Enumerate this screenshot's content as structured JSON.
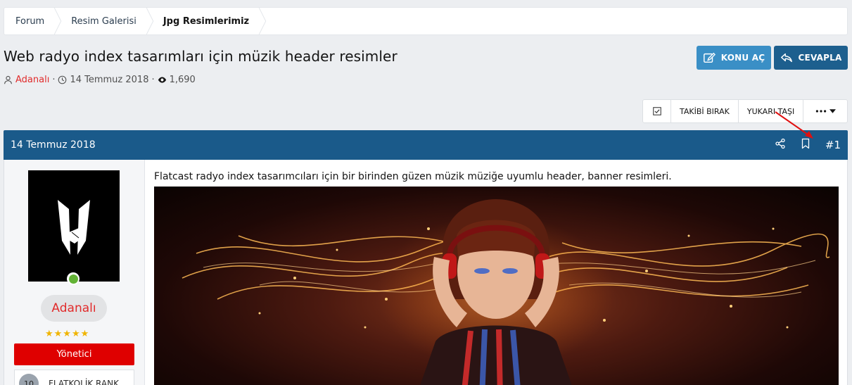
{
  "breadcrumb": {
    "items": [
      {
        "label": "Forum"
      },
      {
        "label": "Resim Galerisi"
      },
      {
        "label": "Jpg Resimlerimiz"
      }
    ]
  },
  "thread": {
    "title": "Web radyo index tasarımları için müzik header resimler",
    "author": "Adanalı",
    "date": "14 Temmuz 2018",
    "views": "1,690"
  },
  "buttons": {
    "new_topic": "KONU AÇ",
    "reply": "CEVAPLA"
  },
  "actions": {
    "unfollow": "TAKİBİ BIRAK",
    "move_up": "YUKARI TAŞI"
  },
  "post": {
    "date": "14 Temmuz 2018",
    "number": "#1",
    "text": "Flatcast radyo index tasarımcıları için bir birinden güzen müzik müziğe uyumlu header, banner resimleri."
  },
  "user": {
    "name": "Adanalı",
    "stars": "★★★★★",
    "role": "Yönetici",
    "rank_level": "10",
    "rank_label": "FLATKOLİK RANK"
  },
  "colors": {
    "header_blue": "#1a5a8a",
    "konu_button": "#3a8fc6",
    "reply_button": "#1d5f8e",
    "role_red": "#df0000",
    "author_red": "#e12b2b"
  }
}
